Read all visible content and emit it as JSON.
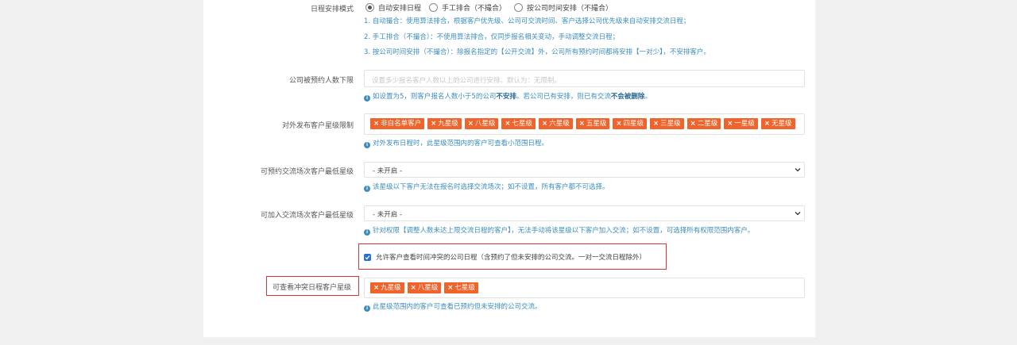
{
  "schedule_mode": {
    "label": "日程安排模式",
    "options": [
      {
        "label": "自动安排日程",
        "checked": true
      },
      {
        "label": "手工排合（不撮合）",
        "checked": false
      },
      {
        "label": "按公司时间安排（不撮合）",
        "checked": false
      }
    ],
    "desc1": "1. 自动撮合：使用算法排合，根据客户优先级、公司可交流时间、客户选择公司优先级来自动安排交流日程；",
    "desc2": "2. 手工排合（不撮合）：不使用算法排合，仅同步报名相关变动，手动调整交流日程；",
    "desc3": "3. 按公司时间安排（不撮合）：除报名指定的【公开交流】外，公司所有预约时间都将安排【一对少】，不安排客户。"
  },
  "min_booking": {
    "label": "公司被预约人数下限",
    "placeholder": "设置多少报名客户人数以上的公司进行安排。默认为：无限制。",
    "desc_pre": "如设置为5，则客户报名人数小于5的公司",
    "desc_b1": "不安排",
    "desc_mid": "。若公司已有安排，则已有交流",
    "desc_b2": "不会被删除",
    "desc_end": "。"
  },
  "publish_star": {
    "label": "对外发布客户星级限制",
    "tags": [
      "非白名单客户",
      "九星级",
      "八星级",
      "七星级",
      "六星级",
      "五星级",
      "四星级",
      "三星级",
      "二星级",
      "一星级",
      "无星级"
    ],
    "desc": "对外发布日程时，此星级范围内的客户可查看小范围日程。"
  },
  "bookable_star": {
    "label": "可预约交流场次客户最低星级",
    "value": "- 未开启 -",
    "desc": "该星级以下客户无法在报名时选择交流场次；如不设置，所有客户都不可选择。"
  },
  "joinable_star": {
    "label": "可加入交流场次客户最低星级",
    "value": "- 未开启 -",
    "desc": "针对权限【调整人数未达上限交流日程的客户】，无法手动将该星级以下客户加入交流；如不设置，可选择所有权限范围内客户。"
  },
  "conflict": {
    "checkbox_label": "允许客户查看时间冲突的公司日程（含预约了但未安排的公司交流。一对一交流日程除外）",
    "checked": true,
    "label": "可查看冲突日程客户星级",
    "tags": [
      "九星级",
      "八星级",
      "七星级"
    ],
    "desc": "此星级范围内的客户可查看已预约但未安排的公司交流。"
  },
  "colors": {
    "accent": "#3c8dbc",
    "tag": "#f0632b",
    "highlight": "#e03434",
    "checkbox": "#2a6fd6"
  }
}
